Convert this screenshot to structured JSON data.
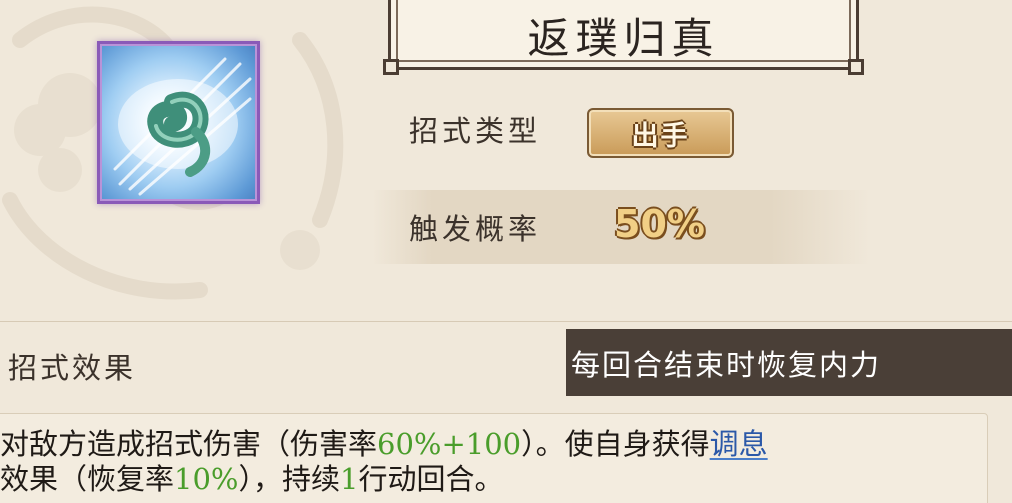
{
  "skill": {
    "name": "返璞归真",
    "type_label": "招式类型",
    "type_value": "出手",
    "rate_label": "触发概率",
    "rate_value": "50%",
    "effect_label": "招式效果"
  },
  "tooltip": {
    "text": "每回合结束时恢复内力"
  },
  "description": {
    "line1_a": "对敌方造成招式伤害（伤害率",
    "line1_b": "60%+100",
    "line1_c": "）。使自身获得",
    "line1_link": "调息",
    "line2_a": "效果（恢复率",
    "line2_b": "10%",
    "line2_c": "），持续",
    "line2_d": "1",
    "line2_e": "行动回合。"
  },
  "colors": {
    "background": "#f0e8da",
    "highlight_green": "#4a9d2b",
    "link_blue": "#2b58a8",
    "tooltip_bg": "#4a3f37",
    "icon_frame": "#8a5ab8"
  },
  "icons": {
    "skill_icon": "jade-swirl-icon",
    "decoration": "cloud-swirl-icon"
  }
}
